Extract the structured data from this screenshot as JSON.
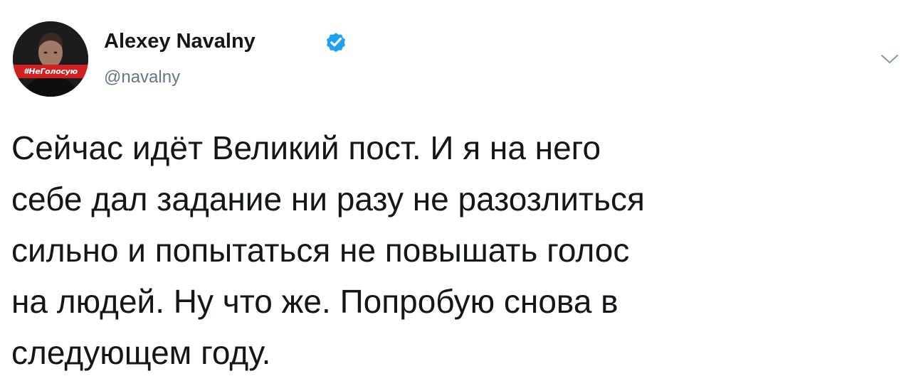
{
  "tweet": {
    "author": {
      "display_name": "Alexey Navalny",
      "handle": "@navalny",
      "verified": true,
      "avatar_hashtag": "#НеГолосую",
      "avatar_tag_color": "#d21f1f",
      "verified_color": "#1da1f2"
    },
    "text_lines": [
      "Сейчас идёт Великий пост. И я на него",
      "себе дал задание ни разу не разозлиться",
      "сильно и попытаться не повышать голос",
      "на людей. Ну что же. Попробую снова в",
      "следующем году."
    ],
    "menu_icon": "chevron-down-icon"
  }
}
